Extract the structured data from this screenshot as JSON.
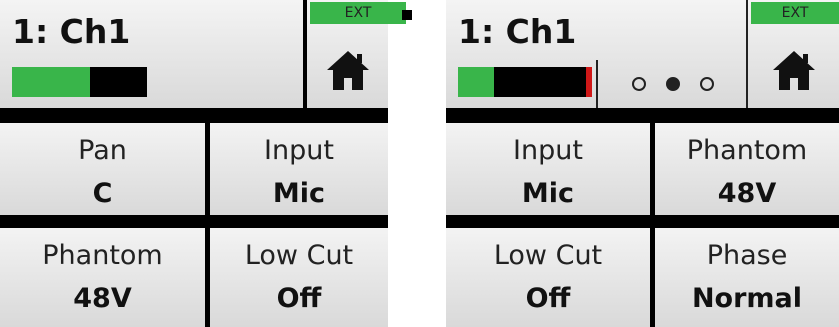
{
  "screens": [
    {
      "channel_title": "1: Ch1",
      "ext_label": "EXT",
      "meter_level": 0.58,
      "peak": false,
      "params": [
        {
          "label": "Pan",
          "value": "C"
        },
        {
          "label": "Input",
          "value": "Mic"
        },
        {
          "label": "Phantom",
          "value": "48V"
        },
        {
          "label": "Low Cut",
          "value": "Off"
        }
      ],
      "page_dots": []
    },
    {
      "channel_title": "1: Ch1",
      "ext_label": "EXT",
      "meter_level": 0.27,
      "peak": true,
      "params": [
        {
          "label": "Input",
          "value": "Mic"
        },
        {
          "label": "Phantom",
          "value": "48V"
        },
        {
          "label": "Low Cut",
          "value": "Off"
        },
        {
          "label": "Phase",
          "value": "Normal"
        }
      ],
      "page_dots": [
        false,
        true,
        false
      ]
    }
  ],
  "colors": {
    "meter_green": "#39b54a",
    "peak_red": "#d01818",
    "ext_green": "#39b54a"
  },
  "icons": {
    "home": "home-icon"
  }
}
